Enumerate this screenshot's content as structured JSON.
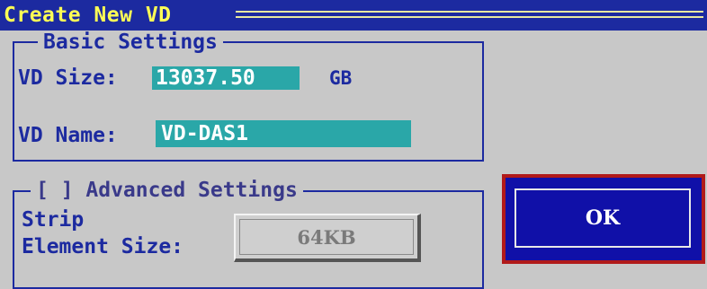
{
  "dialog": {
    "title": "Create New VD"
  },
  "basic_settings": {
    "legend": "Basic Settings",
    "vd_size_label": "VD Size:",
    "vd_size_value": "13037.50",
    "vd_size_unit": "GB",
    "vd_name_label": "VD Name:",
    "vd_name_value": "VD-DAS1"
  },
  "advanced_settings": {
    "legend": "[ ] Advanced Settings",
    "strip_label_line1": "Strip",
    "strip_label_line2": "Element Size:",
    "strip_value": "64KB"
  },
  "ok_button": {
    "label": "OK"
  },
  "colors": {
    "background": "#c8c8c8",
    "title_bar": "#1c2aa0",
    "title_text": "#ffff55",
    "field": "#2aa7a8",
    "ok_button": "#1010a8",
    "focus_border": "#b11a1a"
  }
}
